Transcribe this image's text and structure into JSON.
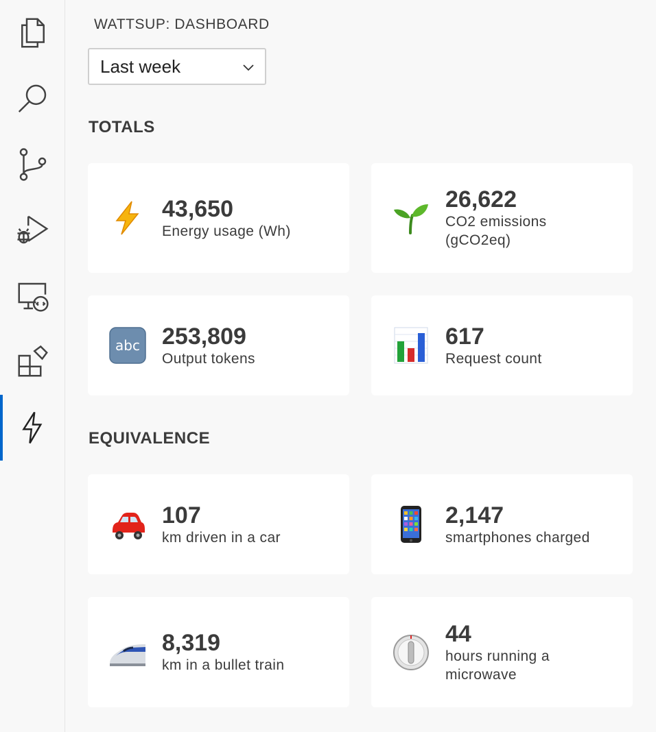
{
  "panel": {
    "title": "WATTSUP: DASHBOARD",
    "range_select": {
      "value": "Last week"
    }
  },
  "sections": {
    "totals": "TOTALS",
    "equivalence": "EQUIVALENCE"
  },
  "totals": [
    {
      "icon": "lightning-icon",
      "value": "43,650",
      "label": "Energy usage (Wh)"
    },
    {
      "icon": "seedling-icon",
      "value": "26,622",
      "label": "CO2 emissions (gCO2eq)"
    },
    {
      "icon": "abc-icon",
      "value": "253,809",
      "label": "Output tokens"
    },
    {
      "icon": "bar-chart-icon",
      "value": "617",
      "label": "Request count"
    }
  ],
  "equivalence": [
    {
      "icon": "car-icon",
      "value": "107",
      "label": "km driven in a car"
    },
    {
      "icon": "smartphone-icon",
      "value": "2,147",
      "label": "smartphones charged"
    },
    {
      "icon": "bullet-train-icon",
      "value": "8,319",
      "label": "km in a bullet train"
    },
    {
      "icon": "timer-icon",
      "value": "44",
      "label": "hours running a microwave"
    }
  ],
  "activity_bar": [
    "explorer-icon",
    "search-icon",
    "source-control-icon",
    "run-debug-icon",
    "remote-explorer-icon",
    "extensions-icon",
    "wattsup-icon"
  ],
  "colors": {
    "accent": "#0066cc",
    "icon_stroke": "#424242"
  }
}
